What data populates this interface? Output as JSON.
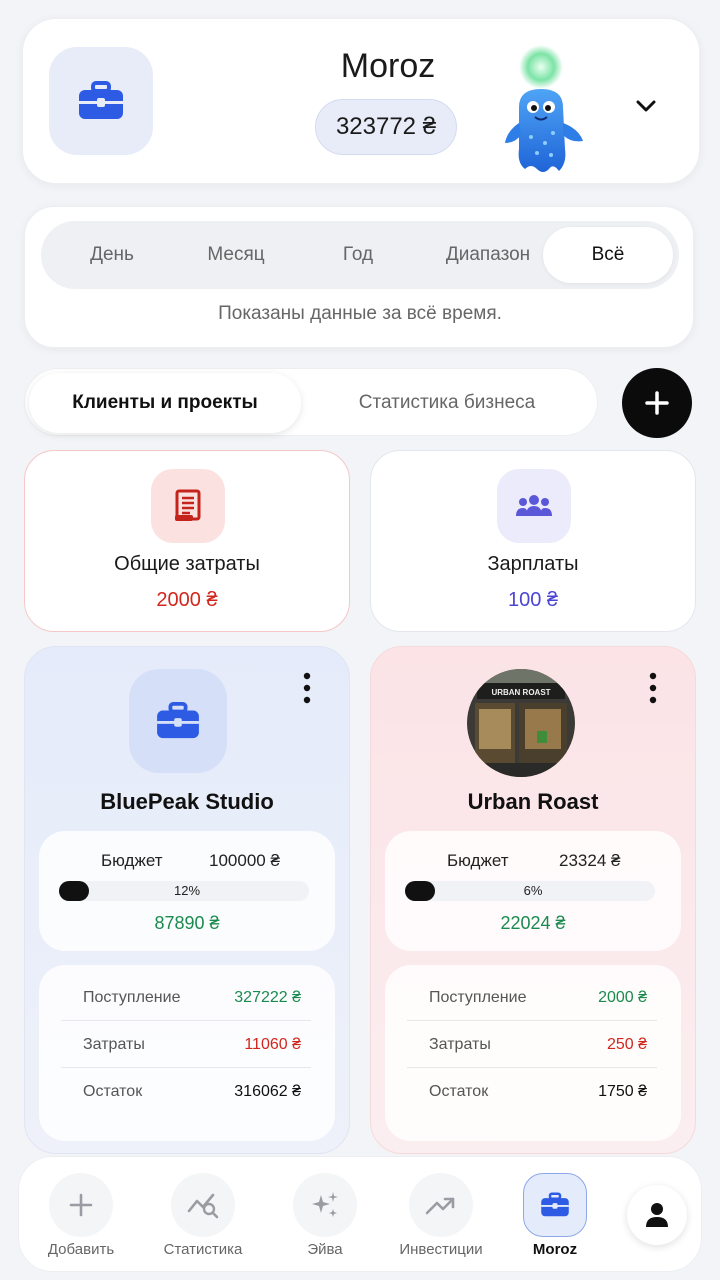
{
  "header": {
    "account_name": "Moroz",
    "balance": "323772 ₴",
    "icon": "briefcase-icon",
    "mascot": "blue-mascot-icon"
  },
  "period": {
    "tabs": [
      "День",
      "Месяц",
      "Год",
      "Диапазон",
      "Всё"
    ],
    "active_index": 4,
    "note": "Показаны данные за всё время."
  },
  "segments": {
    "tabs": [
      "Клиенты и проекты",
      "Статистика бизнеса"
    ],
    "active_index": 0
  },
  "summary": {
    "expenses": {
      "title": "Общие затраты",
      "value": "2000 ₴",
      "color": "#d1271d"
    },
    "salaries": {
      "title": "Зарплаты",
      "value": "100 ₴",
      "color": "#4b45d6"
    }
  },
  "projects": [
    {
      "name": "BluePeak Studio",
      "budget_label": "Бюджет",
      "budget": "100000 ₴",
      "percent_label": "12%",
      "percent": 0.12,
      "remaining": "87890 ₴",
      "rows": [
        {
          "label": "Поступление",
          "value": "327222 ₴",
          "color": "#1b8a4f"
        },
        {
          "label": "Затраты",
          "value": "11060 ₴",
          "color": "#d1271d"
        },
        {
          "label": "Остаток",
          "value": "316062 ₴",
          "color": "#111111"
        }
      ]
    },
    {
      "name": "Urban Roast",
      "budget_label": "Бюджет",
      "budget": "23324 ₴",
      "percent_label": "6%",
      "percent": 0.06,
      "remaining": "22024 ₴",
      "photo_sign": "URBAN ROAST",
      "rows": [
        {
          "label": "Поступление",
          "value": "2000 ₴",
          "color": "#1b8a4f"
        },
        {
          "label": "Затраты",
          "value": "250 ₴",
          "color": "#d1271d"
        },
        {
          "label": "Остаток",
          "value": "1750 ₴",
          "color": "#111111"
        }
      ]
    }
  ],
  "nav": {
    "items": [
      "Добавить",
      "Статистика",
      "Эйва",
      "Инвестиции",
      "Moroz"
    ],
    "active_index": 4
  },
  "colors": {
    "accent": "#2d5be3",
    "positive": "#1b8a4f",
    "negative": "#d1271d"
  }
}
